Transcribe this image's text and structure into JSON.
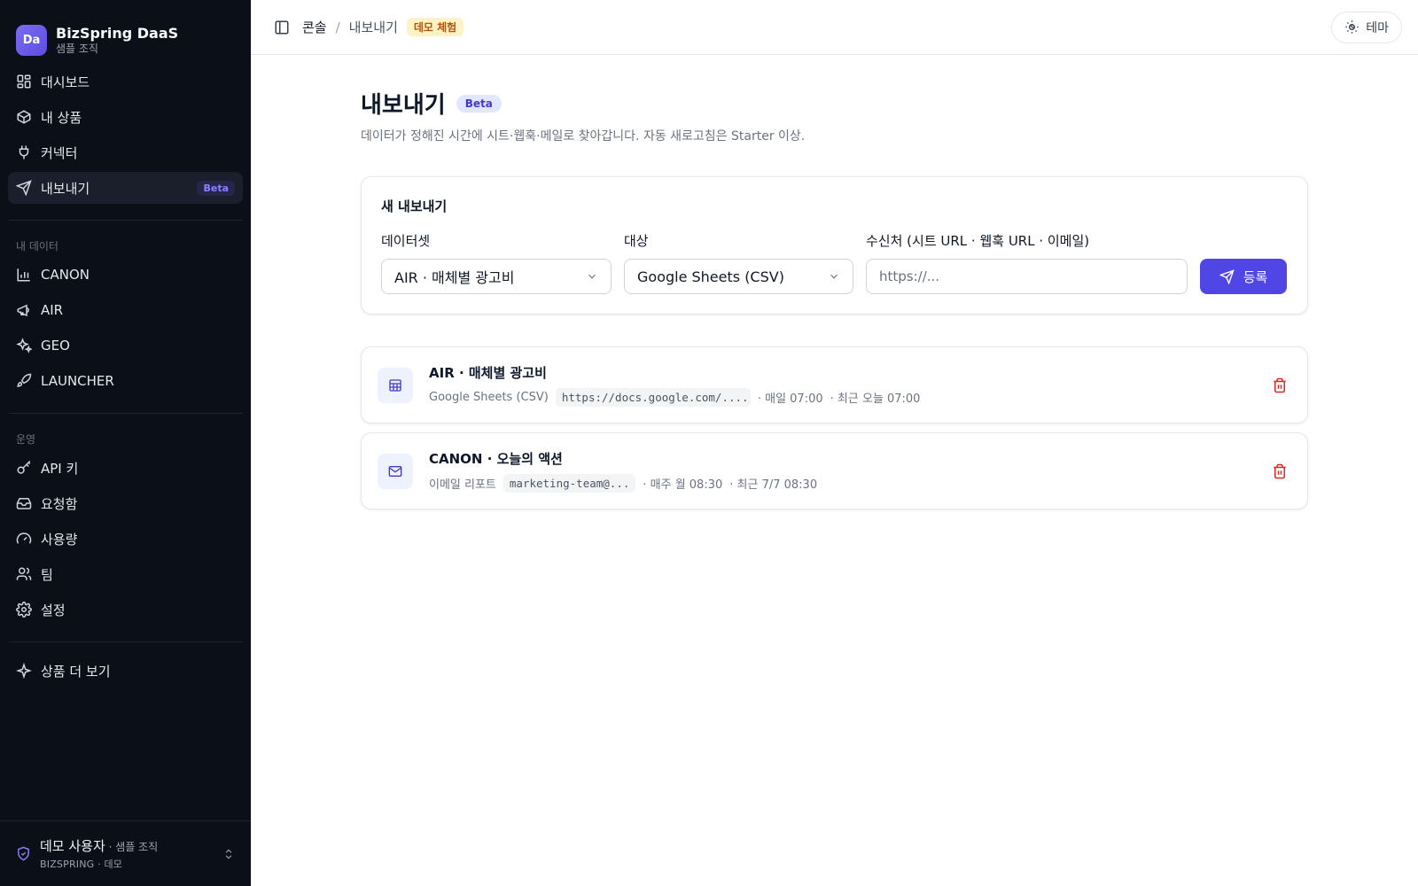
{
  "brand": {
    "logo_text": "Da",
    "name": "BizSpring DaaS",
    "org": "샘플 조직"
  },
  "nav_main": [
    {
      "label": "대시보드",
      "icon": "dashboard-icon"
    },
    {
      "label": "내 상품",
      "icon": "package-icon"
    },
    {
      "label": "커넥터",
      "icon": "plug-icon"
    },
    {
      "label": "내보내기",
      "icon": "send-icon",
      "badge": "Beta",
      "active": true
    }
  ],
  "section_data": {
    "label": "내 데이터"
  },
  "nav_data": [
    {
      "label": "CANON",
      "icon": "bar-chart-icon"
    },
    {
      "label": "AIR",
      "icon": "megaphone-icon"
    },
    {
      "label": "GEO",
      "icon": "sparkles-icon"
    },
    {
      "label": "LAUNCHER",
      "icon": "rocket-icon"
    }
  ],
  "section_ops": {
    "label": "운영"
  },
  "nav_ops": [
    {
      "label": "API 키",
      "icon": "key-icon"
    },
    {
      "label": "요청함",
      "icon": "inbox-icon"
    },
    {
      "label": "사용량",
      "icon": "gauge-icon"
    },
    {
      "label": "팀",
      "icon": "users-icon"
    },
    {
      "label": "설정",
      "icon": "gear-icon"
    }
  ],
  "nav_more": {
    "label": "상품 더 보기",
    "icon": "sparkle-icon"
  },
  "user": {
    "name": "데모 사용자",
    "org": " · 샘플 조직",
    "sub": "BIZSPRING · 데모"
  },
  "topbar": {
    "crumb_root": "콘솔",
    "crumb_sep": "/",
    "crumb_current": "내보내기",
    "demo_badge": "데모 체험",
    "theme_label": "테마"
  },
  "page": {
    "title": "내보내기",
    "badge": "Beta",
    "description": "데이터가 정해진 시간에 시트·웹훅·메일로 찾아갑니다. 자동 새로고침은 Starter 이상."
  },
  "new_export": {
    "title": "새 내보내기",
    "dataset_label": "데이터셋",
    "dataset_value": "AIR · 매체별 광고비",
    "target_label": "대상",
    "target_value": "Google Sheets (CSV)",
    "recipient_label": "수신처 (시트 URL · 웹훅 URL · 이메일)",
    "recipient_placeholder": "https://...",
    "recipient_value": "",
    "submit_label": "등록"
  },
  "exports": [
    {
      "title": "AIR · 매체별 광고비",
      "icon": "table-icon",
      "target": "Google Sheets (CSV)",
      "destination": "https://docs.google.com/......",
      "schedule": "· 매일 07:00",
      "last_run": "· 최근 오늘 07:00"
    },
    {
      "title": "CANON · 오늘의 액션",
      "icon": "mail-icon",
      "target": "이메일 리포트",
      "destination": "marketing-team@...",
      "schedule": "· 매주 월 08:30",
      "last_run": "· 최근 7/7 08:30"
    }
  ],
  "colors": {
    "sidebar_bg": "#0b0f17",
    "accent": "#4f46e5",
    "danger": "#dc2626",
    "demo_badge_bg": "#fef3c7",
    "demo_badge_fg": "#b45309"
  }
}
